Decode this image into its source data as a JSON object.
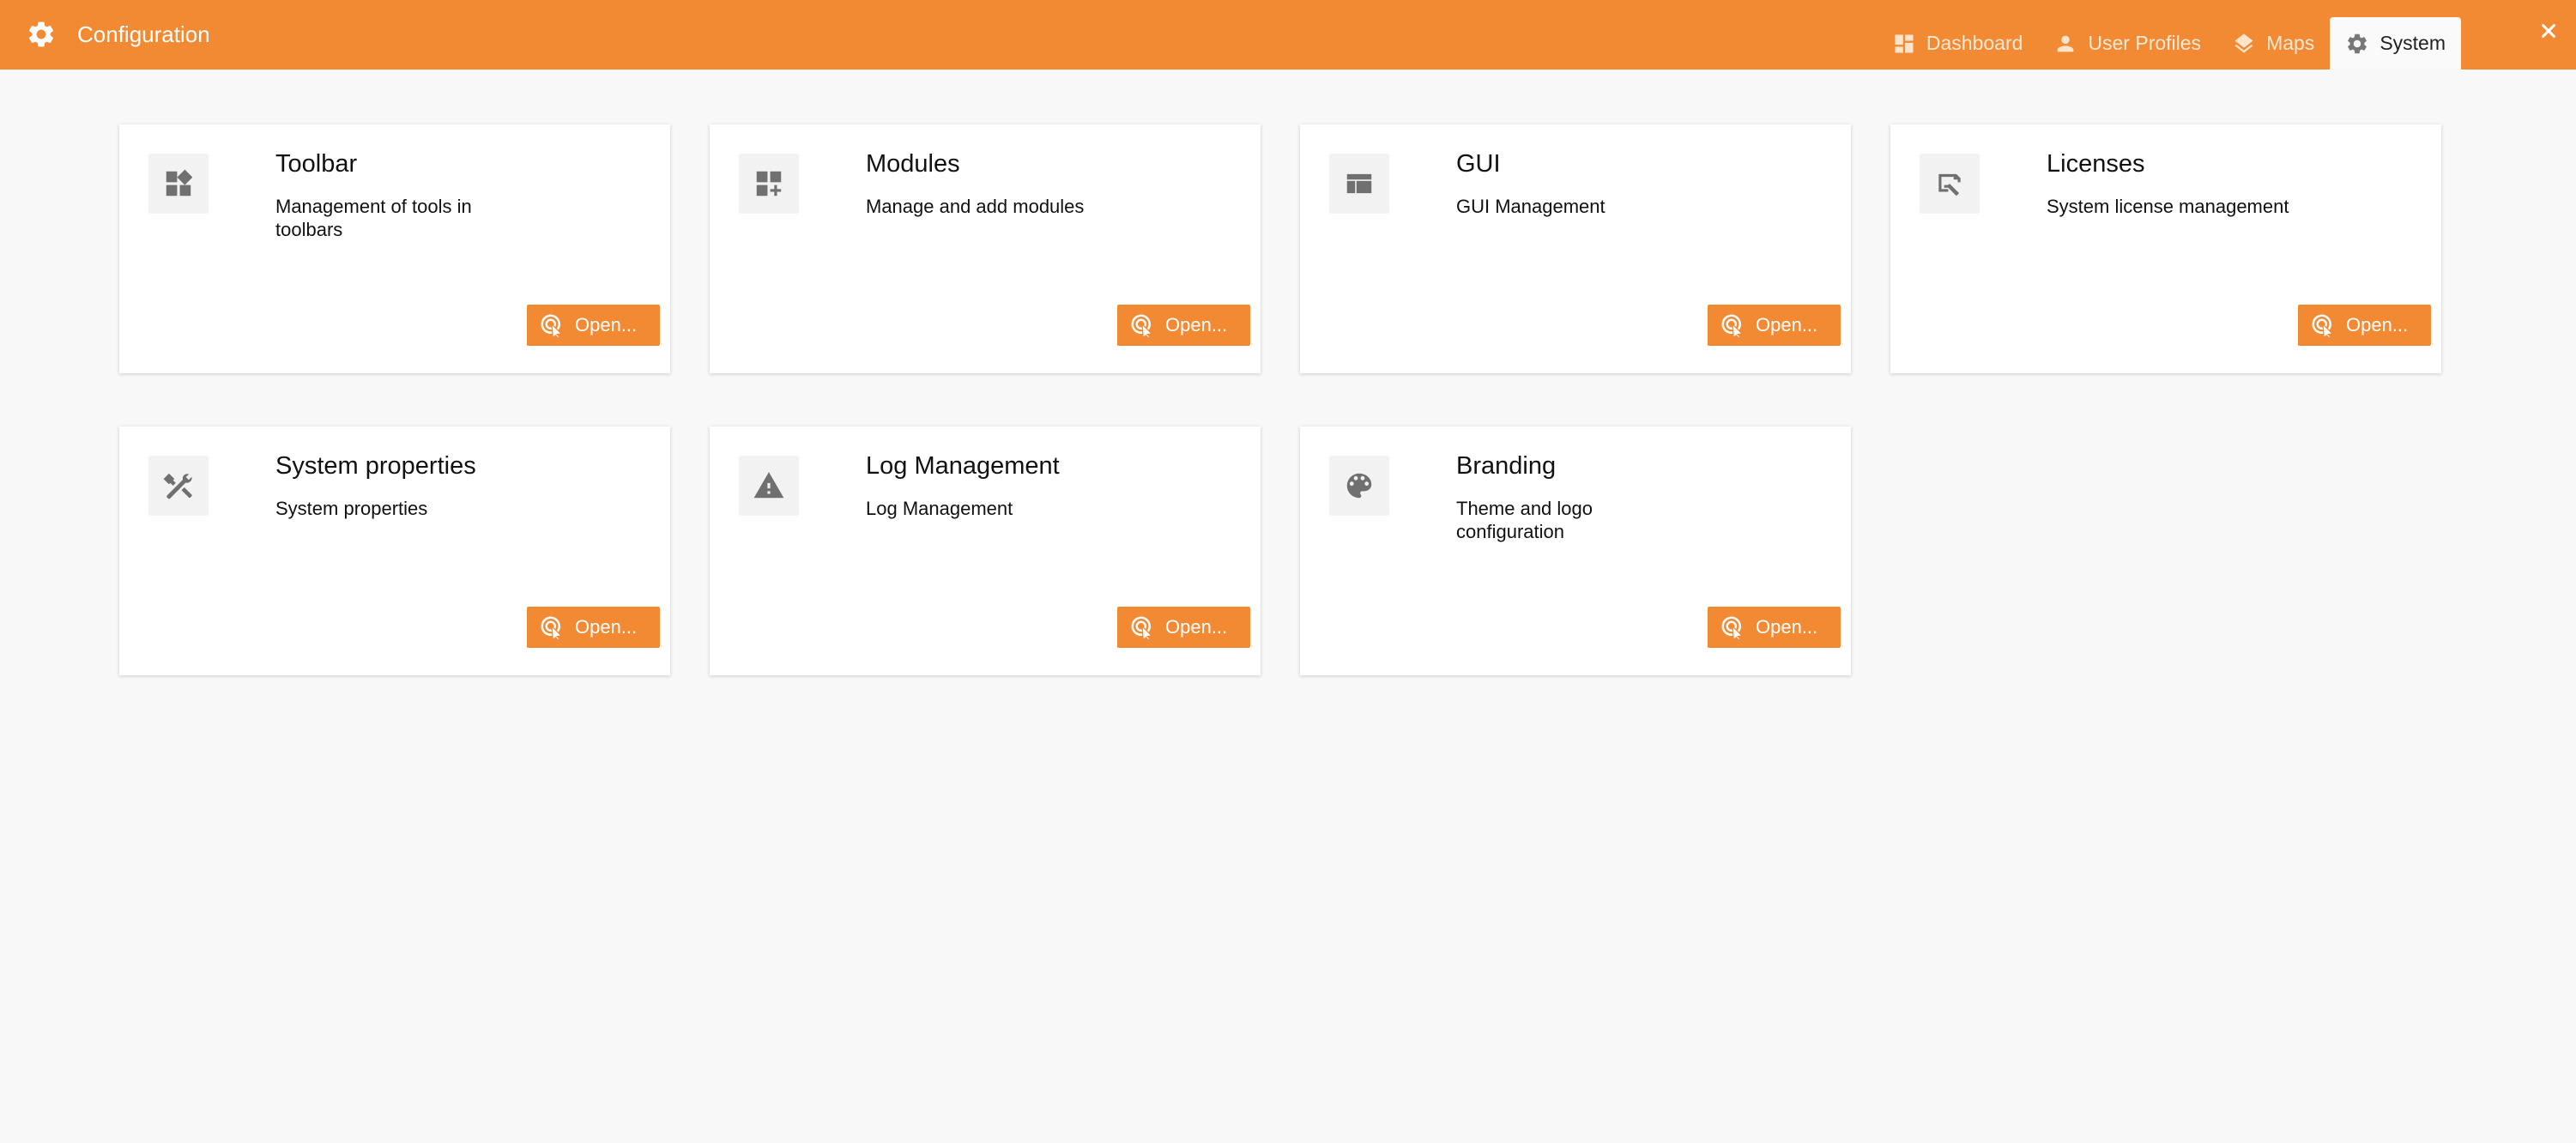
{
  "header": {
    "title": "Configuration",
    "app_icon": "gear-icon",
    "accent_color": "#f28a33",
    "tabs": [
      {
        "label": "Dashboard",
        "icon": "dashboard-icon"
      },
      {
        "label": "User Profiles",
        "icon": "person-icon"
      },
      {
        "label": "Maps",
        "icon": "layers-icon"
      },
      {
        "label": "System",
        "icon": "gear-icon",
        "active": true
      }
    ],
    "close_icon": "close-icon"
  },
  "cards": [
    {
      "title": "Toolbar",
      "description": "Management of tools in toolbars",
      "icon": "widgets-icon",
      "button": "Open..."
    },
    {
      "title": "Modules",
      "description": "Manage and add modules",
      "icon": "add-module-icon",
      "button": "Open..."
    },
    {
      "title": "GUI",
      "description": "GUI Management",
      "icon": "web-layout-icon",
      "button": "Open..."
    },
    {
      "title": "Licenses",
      "description": "System license management",
      "icon": "license-icon",
      "button": "Open..."
    },
    {
      "title": "System properties",
      "description": "System properties",
      "icon": "tools-icon",
      "button": "Open..."
    },
    {
      "title": "Log Management",
      "description": "Log Management",
      "icon": "warning-icon",
      "button": "Open..."
    },
    {
      "title": "Branding",
      "description": "Theme and logo configuration",
      "icon": "palette-icon",
      "button": "Open..."
    }
  ]
}
